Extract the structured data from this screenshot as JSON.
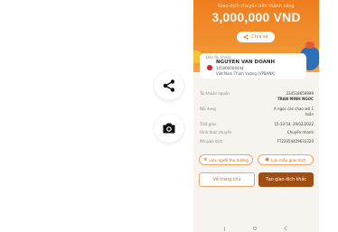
{
  "side_actions": {
    "share_icon": "share-icon",
    "camera_icon": "camera-icon"
  },
  "transfer": {
    "status_text": "Giao dịch chuyển tiền thành công",
    "amount": "3,000,000 VND",
    "share_label": "Chia sẻ"
  },
  "recipient": {
    "label": "Đến tài khoản",
    "name": "NGUYEN VAN DOANH",
    "account": "105000004444",
    "bank": "Việt Nam Thịnh Vượng (VPBANK)"
  },
  "details": [
    {
      "label": "Tài khoản nguồn",
      "value": "234518659999",
      "value2": "TRAN MINH NGOC"
    },
    {
      "label": "Nội dung",
      "value": "A ngoc cac chao adi 1",
      "value2": "tuần"
    },
    {
      "label": "Thời gian",
      "value": "15:33:54, 20/02/2022"
    },
    {
      "label": "Hình thức chuyển",
      "value": "Chuyển nhanh"
    },
    {
      "label": "Mã giao dịch",
      "value": "FT22054429633320"
    }
  ],
  "actions": {
    "save_recipient": "Lưu người thụ hưởng",
    "save_template": "Lưu mẫu giao dịch",
    "home": "Về trang chủ",
    "new_transaction": "Tạo giao dịch khác"
  },
  "colors": {
    "accent": "#ef7d1f",
    "primary_button": "#a04e11",
    "background": "#f7f3ee"
  }
}
